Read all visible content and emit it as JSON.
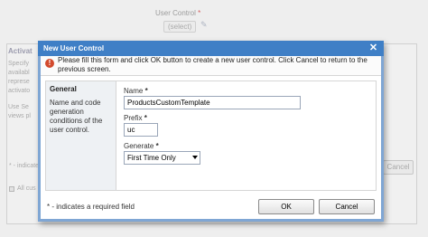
{
  "background": {
    "user_control_label": "User Control",
    "required_marker": "*",
    "select_link": "(select)",
    "section_heading": "Activat",
    "section_desc_lines": [
      "Specify",
      "availabl",
      "represe",
      "activato"
    ],
    "use_text": "Use Se",
    "views_text": "views pl",
    "req_note": "* - indicate",
    "cancel_label": "Cancel",
    "all_label": "All cus"
  },
  "dialog": {
    "title": "New User Control",
    "close_glyph": "✕",
    "info_icon_glyph": "!",
    "info_text": "Please fill this form and click OK button to create a new user control. Click Cancel to return to the previous screen.",
    "section": {
      "title": "General",
      "description": "Name and code generation conditions of the user control."
    },
    "fields": {
      "name": {
        "label": "Name",
        "required": "*",
        "value": "ProductsCustomTemplate"
      },
      "prefix": {
        "label": "Prefix",
        "required": "*",
        "value": "uc"
      },
      "generate": {
        "label": "Generate",
        "required": "*",
        "selected": "First Time Only"
      }
    },
    "footer": {
      "required_note": "* - indicates a required field",
      "ok_label": "OK",
      "cancel_label": "Cancel"
    }
  }
}
